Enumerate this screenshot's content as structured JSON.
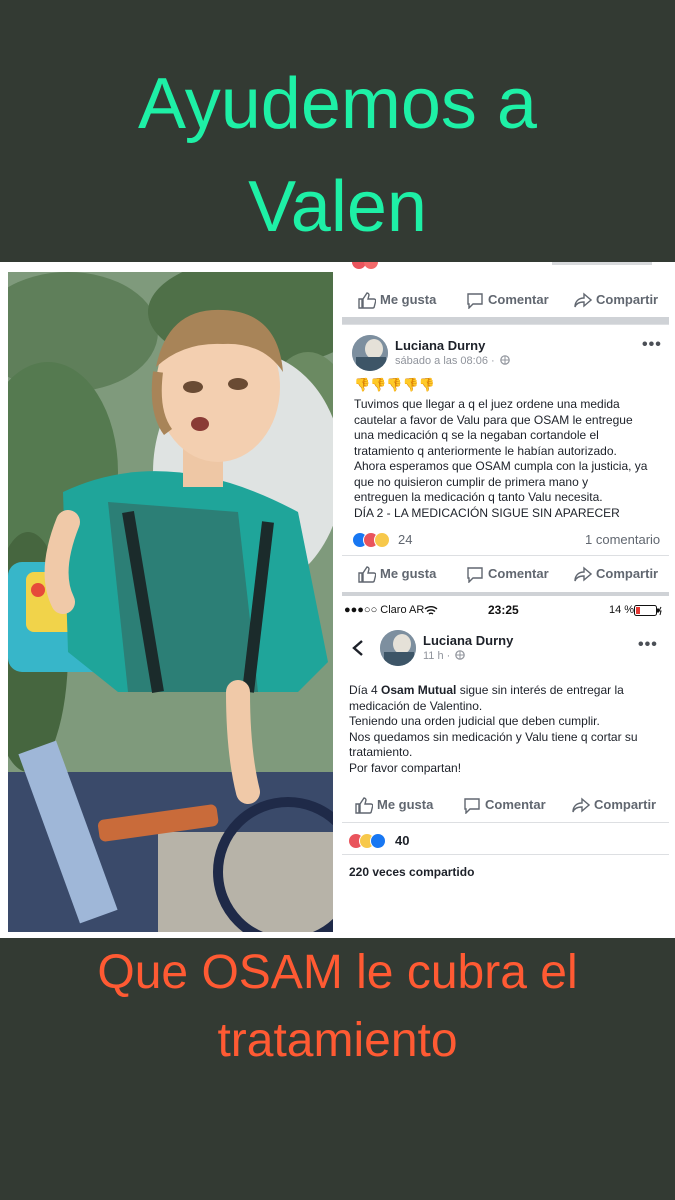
{
  "headline": {
    "line1": "Ayudemos a",
    "line2": "Valen"
  },
  "footer": {
    "line1": "Que OSAM le cubra el",
    "line2": "tratamiento"
  },
  "accent_colors": {
    "headline": "#1ef0a6",
    "footer": "#ff5a33",
    "background": "#333a33"
  },
  "actions": {
    "like": "Me gusta",
    "comment": "Comentar",
    "share": "Compartir"
  },
  "post1": {
    "author": "Luciana Durny",
    "time": "sábado a las 08:06 ·",
    "emoji_row": "👎👎👎👎👎",
    "lines": [
      "Tuvimos que llegar a q el juez ordene una medida",
      "cautelar a favor de Valu para que OSAM le entregue",
      "una medicación q se la negaban cortandole el",
      "tratamiento q anteriormente le habían autorizado.",
      "Ahora esperamos que OSAM cumpla con la justicia, ya",
      "que no quisieron cumplir de primera mano y",
      "entreguen la medicación q tanto Valu necesita.",
      "DÍA 2 - LA MEDICACIÓN SIGUE SIN APARECER"
    ],
    "reaction_count": "24",
    "comments": "1 comentario"
  },
  "statusbar": {
    "carrier": "●●●○○ Claro AR",
    "time": "23:25",
    "battery": "14 %"
  },
  "post2": {
    "author": "Luciana Durny",
    "time": "11 h ·",
    "line1_pre": "Día 4 ",
    "line1_bold": "Osam Mutual",
    "line1_post": " sigue sin interés de entregar la",
    "lines": [
      "medicación de Valentino.",
      "Teniendo una orden judicial que deben cumplir.",
      "Nos quedamos sin medicación y Valu tiene q cortar su",
      "tratamiento.",
      "Por favor compartan!"
    ],
    "reaction_count": "40",
    "shares": "220 veces compartido"
  },
  "icons": [
    "like-icon",
    "comment-icon",
    "share-icon",
    "globe-icon",
    "back-chevron-icon",
    "wifi-icon",
    "battery-icon",
    "more-options-icon"
  ]
}
